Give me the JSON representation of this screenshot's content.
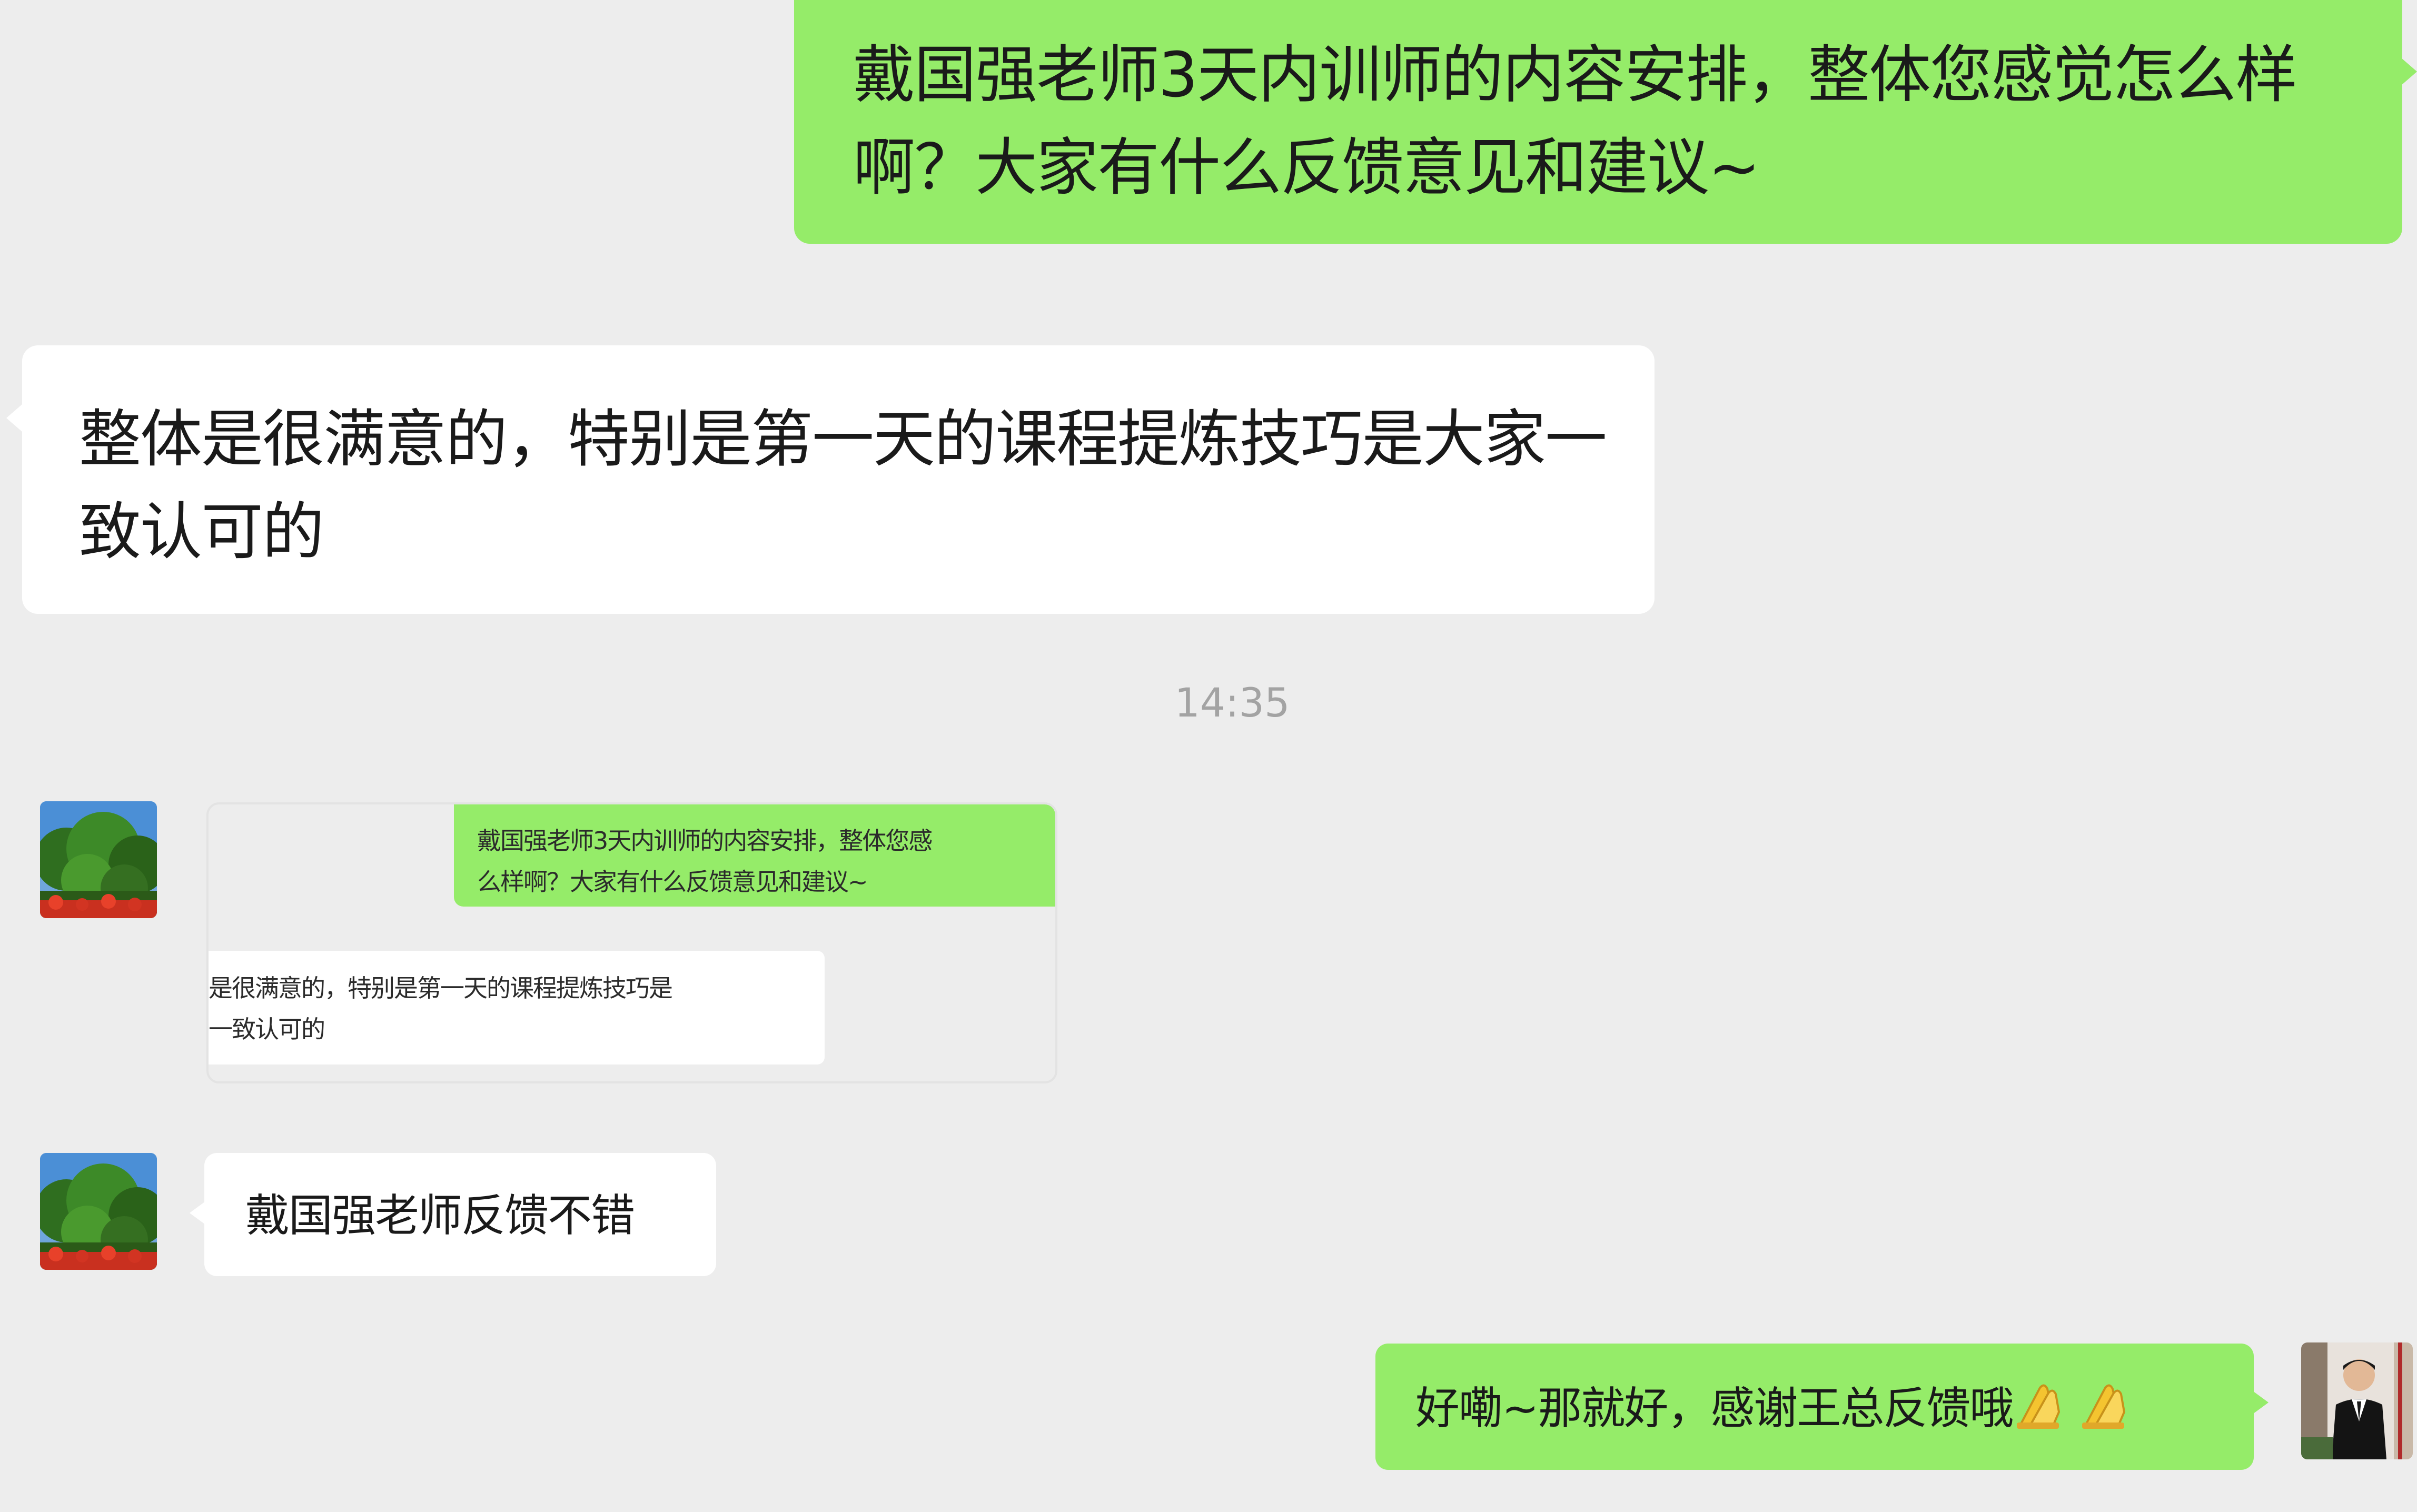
{
  "messages": [
    {
      "id": "msg1",
      "direction": "outgoing",
      "text": "戴国强老师3天内训师的内容安排，整体您感觉怎么样啊？大家有什么反馈意见和建议~"
    },
    {
      "id": "msg2",
      "direction": "incoming",
      "text": "整体是很满意的，特别是第一天的课程提炼技巧是大家一致认可的"
    },
    {
      "id": "timestamp",
      "text": "14:35"
    },
    {
      "id": "quote",
      "direction": "incoming",
      "type": "screenshot",
      "green_text": "戴国强老师3天内训师的内容安排，整体您感\n么样啊？大家有什么反馈意见和建议~",
      "white_text": "是很满意的，特别是第一天的课程提炼技巧是\n一致认可的"
    },
    {
      "id": "msg3",
      "direction": "incoming",
      "text": "戴国强老师反馈不错"
    },
    {
      "id": "msg4",
      "direction": "outgoing",
      "text": "好嘞~那就好，感谢王总反馈哦",
      "emoji": "folded-hands-icon ×2"
    }
  ],
  "colors": {
    "background": "#ededed",
    "outgoing_bubble": "#95ec69",
    "incoming_bubble": "#ffffff",
    "timestamp_text": "#a3a3a3"
  }
}
